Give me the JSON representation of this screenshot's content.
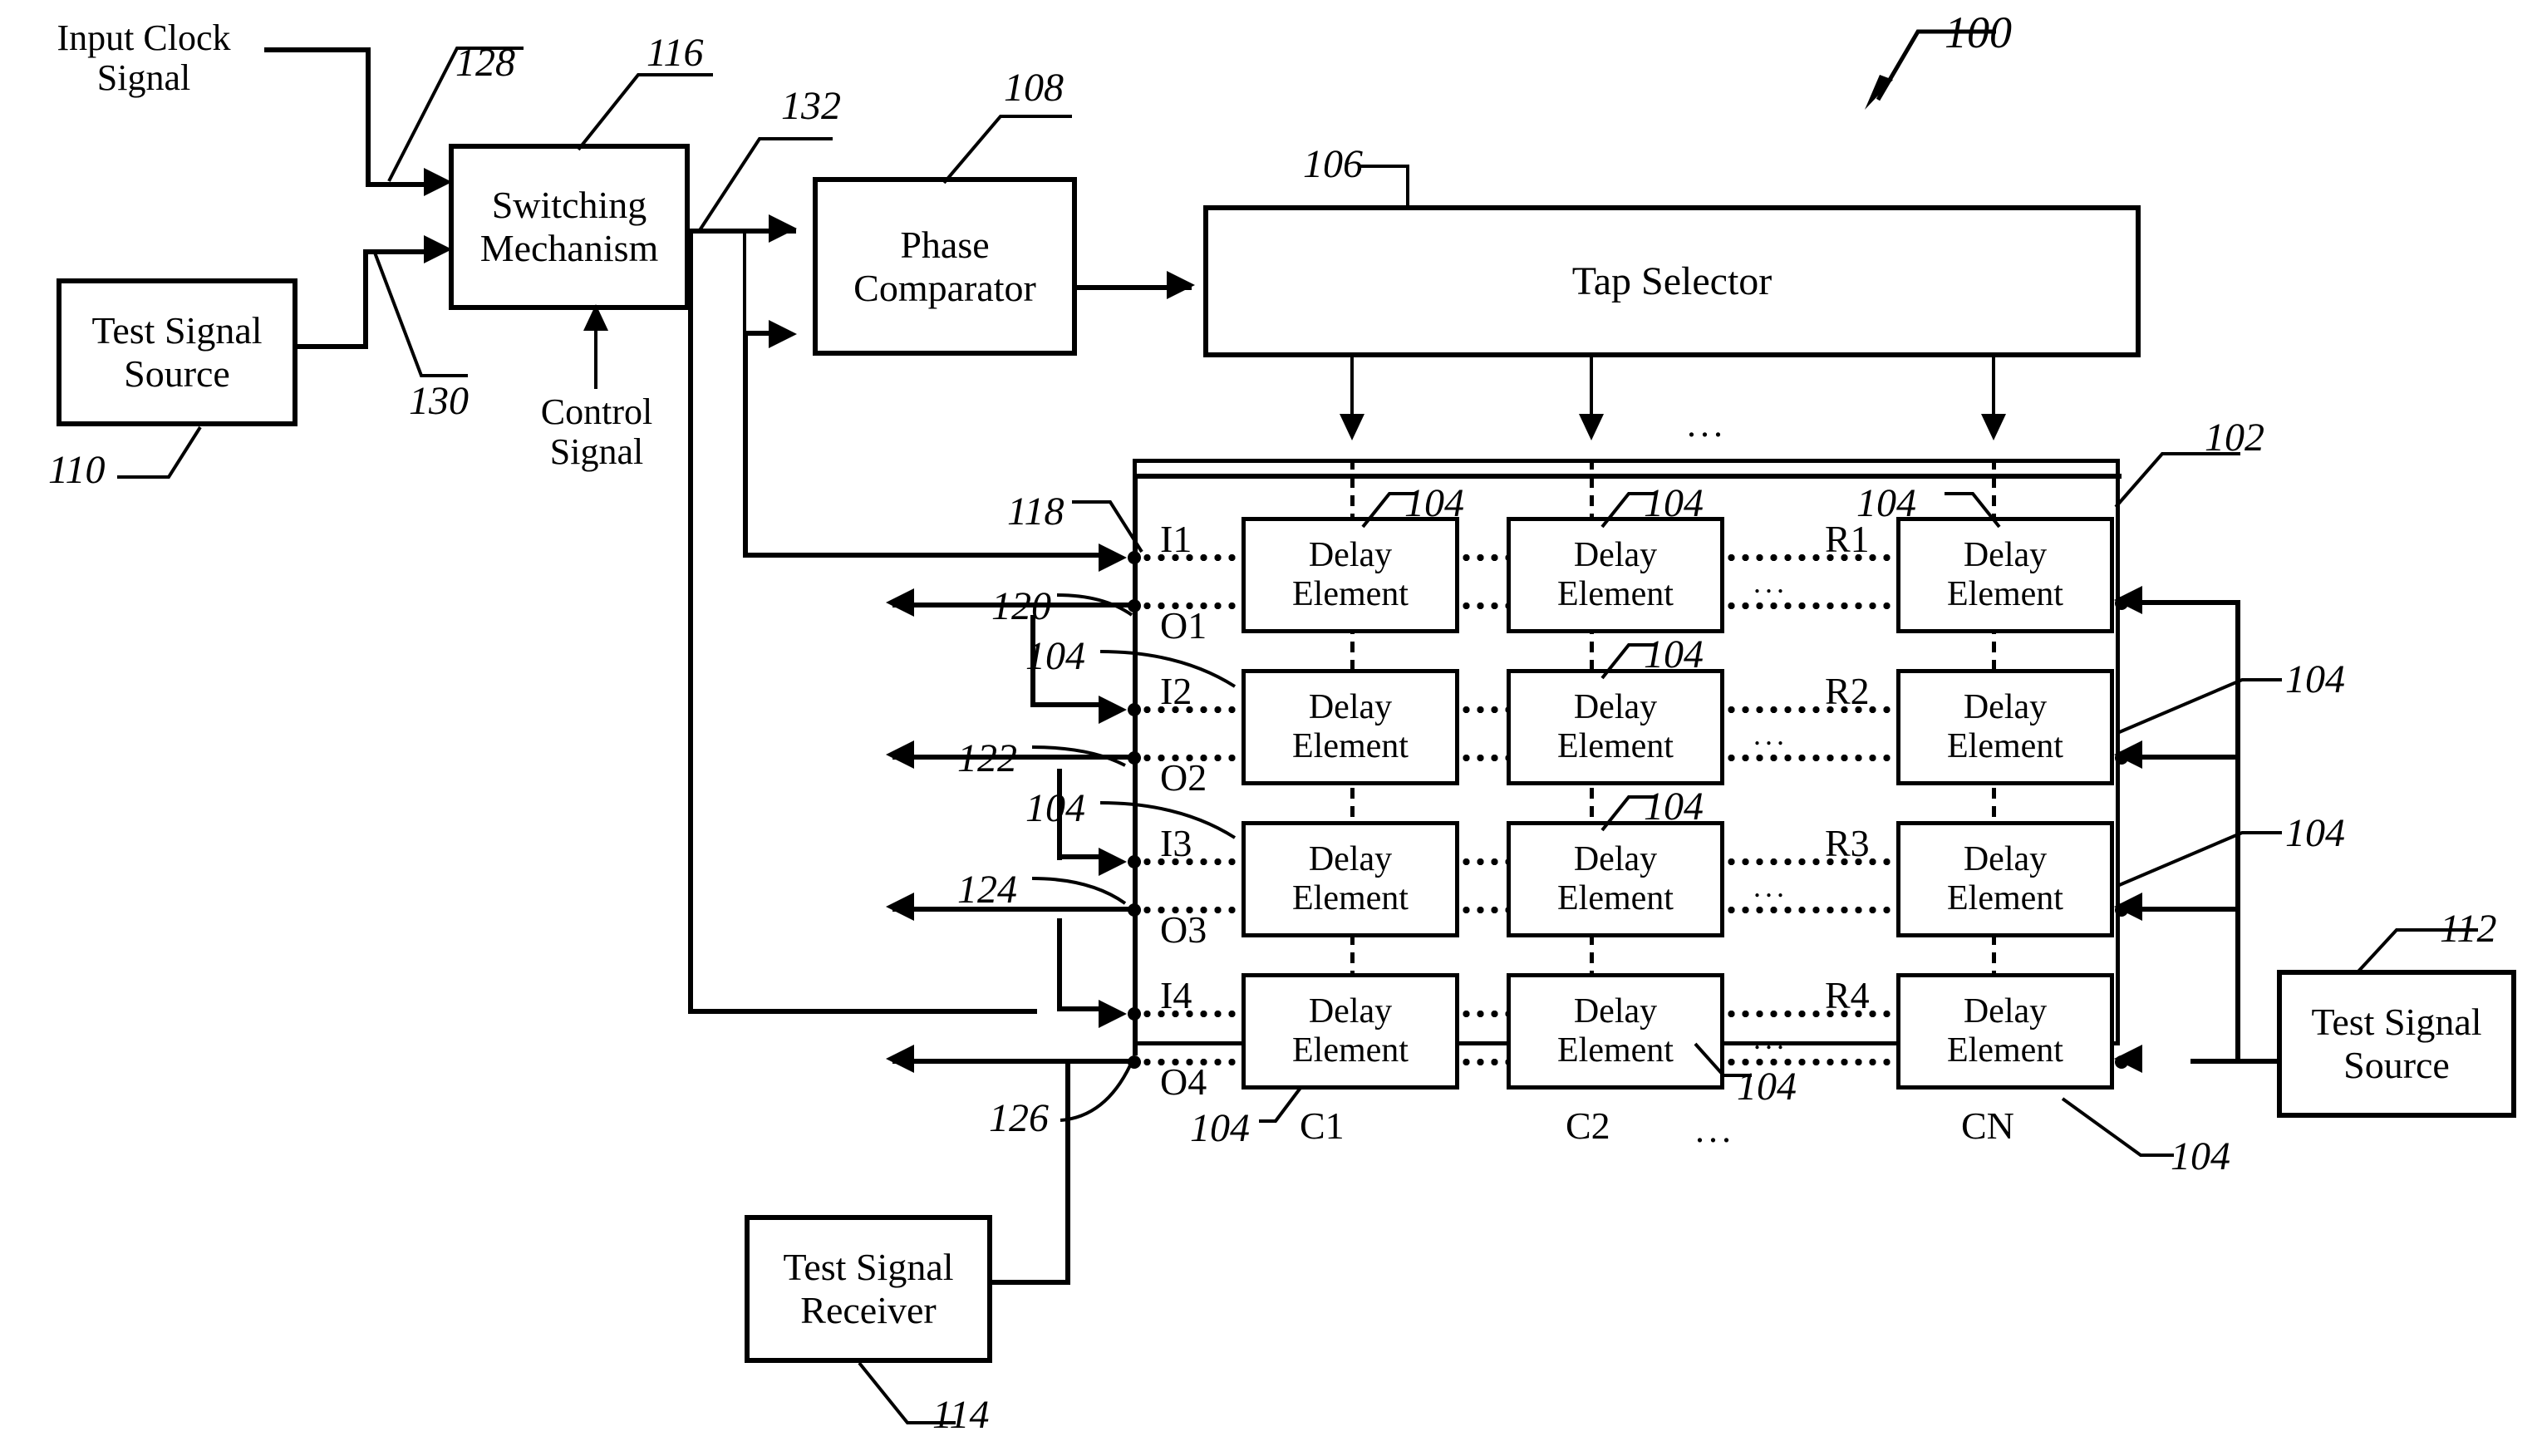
{
  "figure": {
    "id": "100",
    "blocks": {
      "test_signal_source_left": "Test Signal\nSource",
      "test_signal_source_left_line1": "Test Signal",
      "test_signal_source_left_line2": "Source",
      "switching_mechanism_line1": "Switching",
      "switching_mechanism_line2": "Mechanism",
      "phase_comparator_line1": "Phase",
      "phase_comparator_line2": "Comparator",
      "tap_selector": "Tap Selector",
      "delay_element_line1": "Delay",
      "delay_element_line2": "Element",
      "test_signal_source_right_line1": "Test Signal",
      "test_signal_source_right_line2": "Source",
      "test_signal_receiver_line1": "Test Signal",
      "test_signal_receiver_line2": "Receiver"
    },
    "signals": {
      "input_clock_line1": "Input Clock",
      "input_clock_line2": "Signal",
      "control_line1": "Control",
      "control_line2": "Signal"
    },
    "ports": {
      "i1": "I1",
      "o1": "O1",
      "i2": "I2",
      "o2": "O2",
      "i3": "I3",
      "o3": "O3",
      "i4": "I4",
      "o4": "O4",
      "r1": "R1",
      "r2": "R2",
      "r3": "R3",
      "r4": "R4",
      "c1": "C1",
      "c2": "C2",
      "cn": "CN"
    },
    "reference_numerals": {
      "fig": "100",
      "array": "102",
      "delay_element": "104",
      "tap_selector": "106",
      "phase_comparator": "108",
      "test_signal_source_left": "110",
      "test_signal_source_right": "112",
      "test_signal_receiver": "114",
      "switching_mechanism": "116",
      "i1_line": "118",
      "o1_line": "120",
      "o2_line": "122",
      "o3_line": "124",
      "o4_line": "126",
      "clock_input": "128",
      "test_input": "130",
      "switch_output": "132"
    },
    "ellipsis": "...",
    "colors": {
      "ink": "#000000",
      "paper": "#ffffff"
    }
  }
}
